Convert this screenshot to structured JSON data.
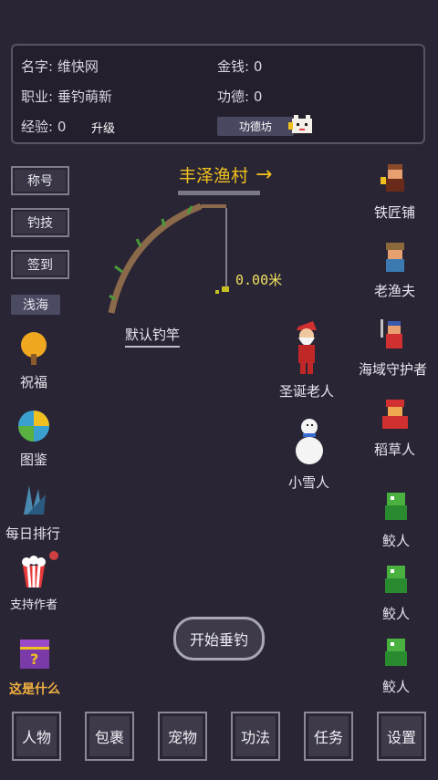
{
  "stats": {
    "name_label": "名字:",
    "name_value": "维快网",
    "job_label": "职业:",
    "job_value": "垂钓萌新",
    "exp_label": "经验:",
    "exp_value": "0",
    "upgrade_label": "升级",
    "money_label": "金钱:",
    "money_value": "0",
    "merit_label": "功德:",
    "merit_value": "0",
    "merit_shop_label": "功德坊"
  },
  "side_buttons": [
    "称号",
    "钓技",
    "签到"
  ],
  "area_tag": "浅海",
  "location": {
    "name": "丰泽渔村",
    "arrow": "→"
  },
  "fishing": {
    "depth": "0.00米",
    "rod_name": "默认钓竿"
  },
  "left_items": [
    "祝福",
    "图鉴",
    "每日排行",
    "支持作者",
    "这是什么"
  ],
  "right_npcs": [
    "铁匠铺",
    "老渔夫",
    "海域守护者",
    "稻草人",
    "鲛人",
    "鲛人",
    "鲛人"
  ],
  "center_npcs": [
    "圣诞老人",
    "小雪人"
  ],
  "start_button": "开始垂钓",
  "bottom_nav": [
    "人物",
    "包裹",
    "宠物",
    "功法",
    "任务",
    "设置"
  ],
  "colors": {
    "background": "#2a2535",
    "accent_yellow": "#f0c020",
    "highlight_orange": "#f0b040"
  }
}
